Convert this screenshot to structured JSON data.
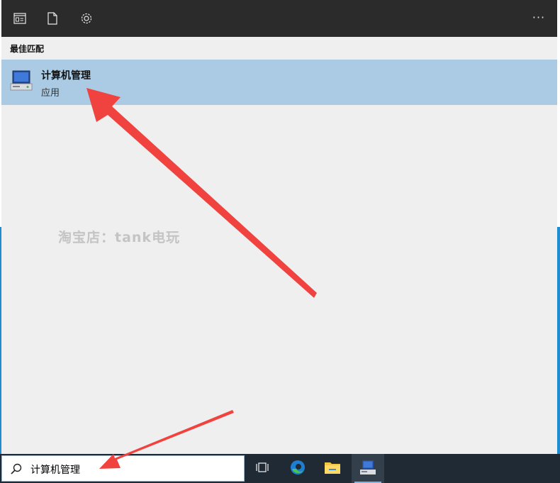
{
  "panel": {
    "section_header": "最佳匹配",
    "more_label": "···",
    "best_match": {
      "title": "计算机管理",
      "subtitle": "应用"
    }
  },
  "watermark": "淘宝店：tank电玩",
  "taskbar": {
    "search_value": "计算机管理",
    "apps": [
      "task-view-icon",
      "edge-icon",
      "file-explorer-icon",
      "computer-management-icon"
    ]
  },
  "colors": {
    "toolbar_bg": "#2b2b2b",
    "panel_bg": "#efefef",
    "highlight_bg": "#aacbe3",
    "taskbar_bg": "#1f2a35",
    "arrow": "#f0433f"
  }
}
